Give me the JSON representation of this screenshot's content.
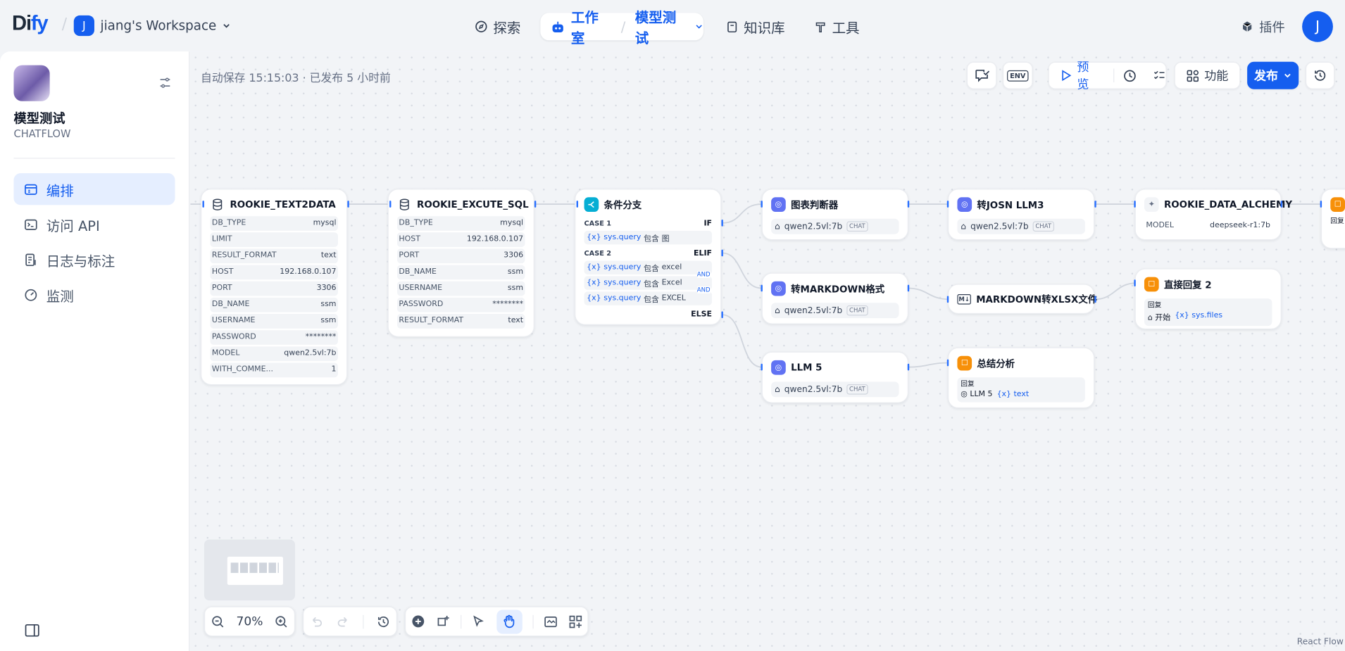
{
  "topbar": {
    "logo_left": "Di",
    "logo_accent": "fy",
    "workspace_initial": "J",
    "workspace_name": "jiang's Workspace",
    "nav_explore": "探索",
    "nav_studio": "工作室",
    "nav_current_app": "模型测试",
    "nav_knowledge": "知识库",
    "nav_tools": "工具",
    "plugins": "插件",
    "user_initial": "J"
  },
  "sidebar": {
    "app_name": "模型测试",
    "app_type": "CHATFLOW",
    "items": [
      {
        "label": "编排"
      },
      {
        "label": "访问 API"
      },
      {
        "label": "日志与标注"
      },
      {
        "label": "监测"
      }
    ]
  },
  "toolbar": {
    "autosave": "自动保存 15:15:03 · 已发布 5 小时前",
    "env": "ENV",
    "preview": "预览",
    "features": "功能",
    "publish": "发布"
  },
  "nodes": {
    "text2data": {
      "title": "ROOKIE_TEXT2DATA",
      "fields": [
        [
          "DB_TYPE",
          "mysql"
        ],
        [
          "LIMIT",
          ""
        ],
        [
          "RESULT_FORMAT",
          "text"
        ],
        [
          "HOST",
          "192.168.0.107"
        ],
        [
          "PORT",
          "3306"
        ],
        [
          "DB_NAME",
          "ssm"
        ],
        [
          "USERNAME",
          "ssm"
        ],
        [
          "PASSWORD",
          "********"
        ],
        [
          "MODEL",
          "qwen2.5vl:7b"
        ],
        [
          "WITH_COMME...",
          "1"
        ]
      ]
    },
    "execute_sql": {
      "title": "ROOKIE_EXCUTE_SQL",
      "fields": [
        [
          "DB_TYPE",
          "mysql"
        ],
        [
          "HOST",
          "192.168.0.107"
        ],
        [
          "PORT",
          "3306"
        ],
        [
          "DB_NAME",
          "ssm"
        ],
        [
          "USERNAME",
          "ssm"
        ],
        [
          "PASSWORD",
          "********"
        ],
        [
          "RESULT_FORMAT",
          "text"
        ]
      ]
    },
    "ifelse": {
      "title": "条件分支",
      "case1": "CASE 1",
      "if": "IF",
      "cond1_var": "sys.query",
      "cond1_op": "包含",
      "cond1_val": "图",
      "case2": "CASE 2",
      "elif": "ELIF",
      "cond2_var": "sys.query",
      "cond2_op": "包含",
      "cond2_val": "excel",
      "cond3_var": "sys.query",
      "cond3_op": "包含",
      "cond3_val": "Excel",
      "cond4_var": "sys.query",
      "cond4_op": "包含",
      "cond4_val": "EXCEL",
      "and": "AND",
      "else": "ELSE"
    },
    "chart_judge": {
      "title": "图表判断器",
      "model": "qwen2.5vl:7b",
      "tag": "CHAT"
    },
    "to_json": {
      "title": "转JOSN LLM3",
      "model": "qwen2.5vl:7b",
      "tag": "CHAT"
    },
    "alchemy": {
      "title": "ROOKIE_DATA_ALCHEMY",
      "key": "MODEL",
      "value": "deepseek-r1:7b"
    },
    "to_markdown": {
      "title": "转MARKDOWN格式",
      "model": "qwen2.5vl:7b",
      "tag": "CHAT"
    },
    "md_xlsx": {
      "title": "MARKDOWN转XLSX文件"
    },
    "reply2": {
      "title": "直接回复 2",
      "label": "回复",
      "src": "开始",
      "var": "sys.files"
    },
    "llm5": {
      "title": "LLM 5",
      "model": "qwen2.5vl:7b",
      "tag": "CHAT"
    },
    "summary": {
      "title": "总结分析",
      "label": "回复",
      "src": "LLM 5",
      "var": "text"
    },
    "partial": {
      "label": "回复"
    }
  },
  "controls": {
    "zoom": "70%"
  },
  "watermark": "React Flow",
  "colors": {
    "accent": "#155eef",
    "ifelse": "#06aed4",
    "llm": "#6172f3",
    "answer": "#f79009"
  }
}
